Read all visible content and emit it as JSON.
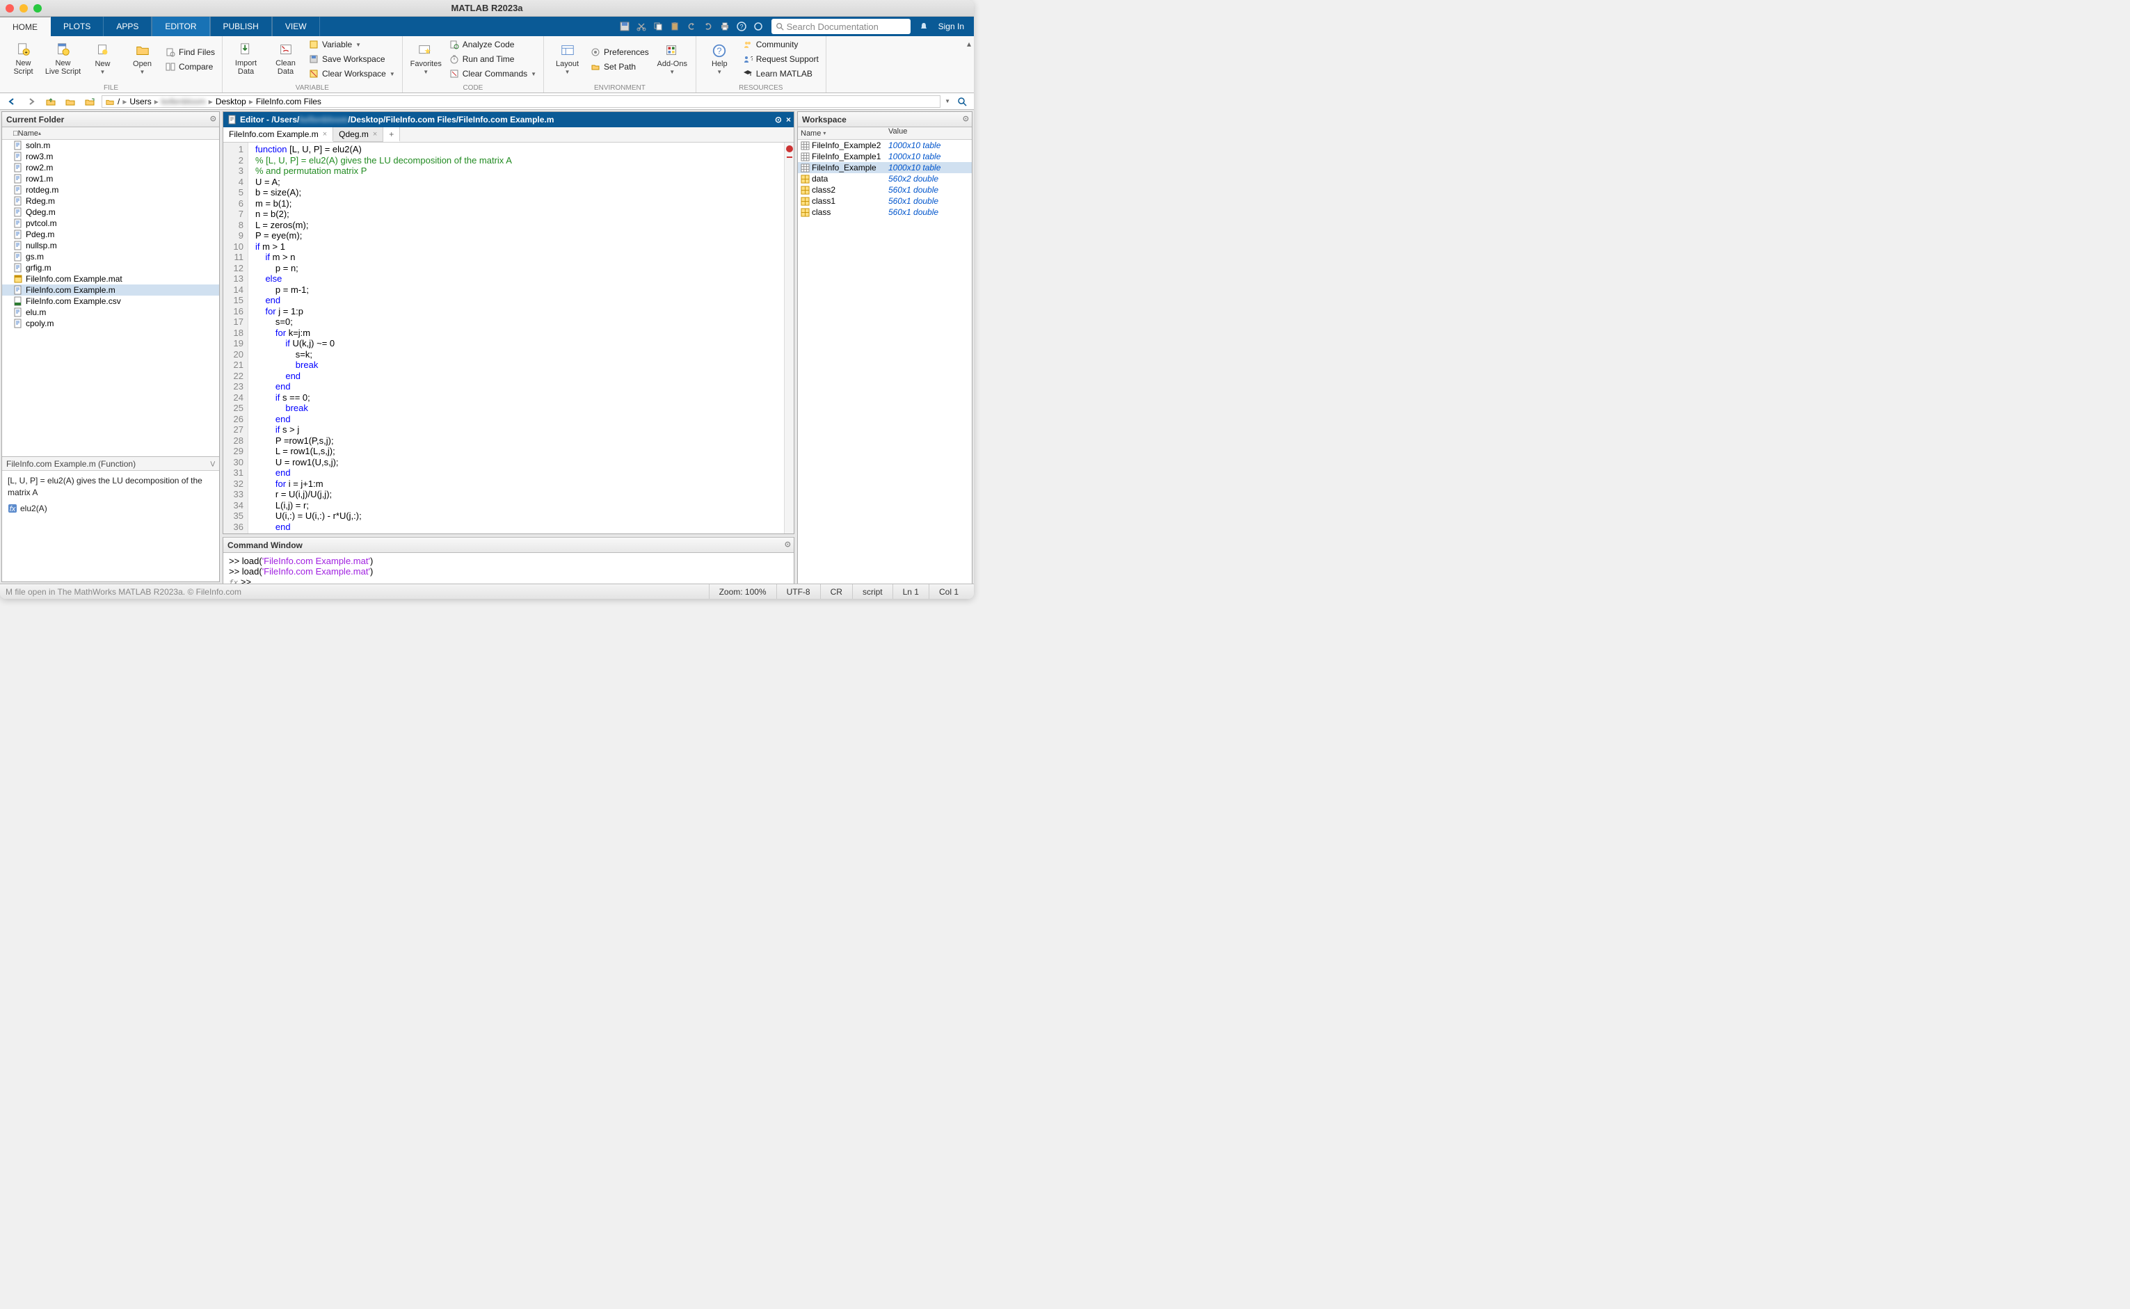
{
  "window_title": "MATLAB R2023a",
  "tabs": {
    "home": "HOME",
    "plots": "PLOTS",
    "apps": "APPS",
    "editor": "EDITOR",
    "publish": "PUBLISH",
    "view": "VIEW"
  },
  "search_placeholder": "Search Documentation",
  "signin_label": "Sign In",
  "toolstrip": {
    "group_file": {
      "label": "FILE",
      "new_script": "New\nScript",
      "new_live_script": "New\nLive Script",
      "new": "New",
      "open": "Open",
      "find_files": "Find Files",
      "compare": "Compare"
    },
    "group_variable": {
      "label": "VARIABLE",
      "import": "Import\nData",
      "clean": "Clean\nData",
      "variable": "Variable",
      "save_ws": "Save Workspace",
      "clear_ws": "Clear Workspace"
    },
    "group_code": {
      "label": "CODE",
      "favorites": "Favorites",
      "analyze": "Analyze Code",
      "runtime": "Run and Time",
      "clear_cmds": "Clear Commands"
    },
    "group_env": {
      "label": "ENVIRONMENT",
      "layout": "Layout",
      "preferences": "Preferences",
      "setpath": "Set Path"
    },
    "group_addons": {
      "addons": "Add-Ons",
      "help": "Help"
    },
    "group_res": {
      "label": "RESOURCES",
      "community": "Community",
      "support": "Request Support",
      "learn": "Learn MATLAB"
    }
  },
  "path": {
    "root": "/",
    "users": "Users",
    "blurred_user": "kellenbloom",
    "desktop": "Desktop",
    "folder": "FileInfo.com Files"
  },
  "current_folder": {
    "title": "Current Folder",
    "col_name": "Name",
    "files": [
      {
        "name": "soln.m",
        "type": "m"
      },
      {
        "name": "row3.m",
        "type": "m"
      },
      {
        "name": "row2.m",
        "type": "m"
      },
      {
        "name": "row1.m",
        "type": "m"
      },
      {
        "name": "rotdeg.m",
        "type": "m"
      },
      {
        "name": "Rdeg.m",
        "type": "m"
      },
      {
        "name": "Qdeg.m",
        "type": "m"
      },
      {
        "name": "pvtcol.m",
        "type": "m"
      },
      {
        "name": "Pdeg.m",
        "type": "m"
      },
      {
        "name": "nullsp.m",
        "type": "m"
      },
      {
        "name": "gs.m",
        "type": "m"
      },
      {
        "name": "grfig.m",
        "type": "m"
      },
      {
        "name": "FileInfo.com Example.mat",
        "type": "mat"
      },
      {
        "name": "FileInfo.com Example.m",
        "type": "m",
        "selected": true
      },
      {
        "name": "FileInfo.com Example.csv",
        "type": "csv"
      },
      {
        "name": "elu.m",
        "type": "m"
      },
      {
        "name": "cpoly.m",
        "type": "m"
      }
    ]
  },
  "detail": {
    "title": "FileInfo.com Example.m  (Function)",
    "body": "[L, U, P] = elu2(A) gives the LU decomposition of the matrix A",
    "fn": "elu2(A)"
  },
  "editor": {
    "title": "Editor - /Users/",
    "title_suffix": "/Desktop/FileInfo.com Files/FileInfo.com Example.m",
    "tabs": [
      {
        "name": "FileInfo.com Example.m",
        "active": true
      },
      {
        "name": "Qdeg.m",
        "active": false
      }
    ],
    "code_lines": [
      [
        [
          "kw",
          "function"
        ],
        [
          "",
          " [L, U, P] = elu2(A)"
        ]
      ],
      [
        [
          "cm",
          "% [L, U, P] = elu2(A) gives the LU decomposition of the matrix A"
        ]
      ],
      [
        [
          "cm",
          "% and permutation matrix P"
        ]
      ],
      [
        [
          "",
          "U = A;"
        ]
      ],
      [
        [
          "",
          "b = size(A);"
        ]
      ],
      [
        [
          "",
          "m = b(1);"
        ]
      ],
      [
        [
          "",
          "n = b(2);"
        ]
      ],
      [
        [
          "",
          "L = zeros(m);"
        ]
      ],
      [
        [
          "",
          "P = eye(m);"
        ]
      ],
      [
        [
          "kw",
          "if"
        ],
        [
          "",
          " m > 1"
        ]
      ],
      [
        [
          "",
          "    "
        ],
        [
          "kw",
          "if"
        ],
        [
          "",
          " m > n"
        ]
      ],
      [
        [
          "",
          "        p = n;"
        ]
      ],
      [
        [
          "",
          "    "
        ],
        [
          "kw",
          "else"
        ]
      ],
      [
        [
          "",
          "        p = m-1;"
        ]
      ],
      [
        [
          "",
          "    "
        ],
        [
          "kw",
          "end"
        ]
      ],
      [
        [
          "",
          "    "
        ],
        [
          "kw",
          "for"
        ],
        [
          "",
          " j = 1:p"
        ]
      ],
      [
        [
          "",
          "        s=0;"
        ]
      ],
      [
        [
          "",
          "        "
        ],
        [
          "kw",
          "for"
        ],
        [
          "",
          " k=j:m"
        ]
      ],
      [
        [
          "",
          "            "
        ],
        [
          "kw",
          "if"
        ],
        [
          "",
          " U(k,j) ~= 0"
        ]
      ],
      [
        [
          "",
          "                s=k;"
        ]
      ],
      [
        [
          "",
          "                "
        ],
        [
          "kw",
          "break"
        ]
      ],
      [
        [
          "",
          "            "
        ],
        [
          "kw",
          "end"
        ]
      ],
      [
        [
          "",
          "        "
        ],
        [
          "kw",
          "end"
        ]
      ],
      [
        [
          "",
          "        "
        ],
        [
          "kw",
          "if"
        ],
        [
          "",
          " s == 0;"
        ]
      ],
      [
        [
          "",
          "            "
        ],
        [
          "kw",
          "break"
        ]
      ],
      [
        [
          "",
          "        "
        ],
        [
          "kw",
          "end"
        ]
      ],
      [
        [
          "",
          "        "
        ],
        [
          "kw",
          "if"
        ],
        [
          "",
          " s > j"
        ]
      ],
      [
        [
          "",
          "        P =row1(P,s,j);"
        ]
      ],
      [
        [
          "",
          "        L = row1(L,s,j);"
        ]
      ],
      [
        [
          "",
          "        U = row1(U,s,j);"
        ]
      ],
      [
        [
          "",
          "        "
        ],
        [
          "kw",
          "end"
        ]
      ],
      [
        [
          "",
          "        "
        ],
        [
          "kw",
          "for"
        ],
        [
          "",
          " i = j+1:m"
        ]
      ],
      [
        [
          "",
          "        r = U(i,j)/U(j,j);"
        ]
      ],
      [
        [
          "",
          "        L(i,j) = r;"
        ]
      ],
      [
        [
          "",
          "        U(i,:) = U(i,:) - r*U(j,:);"
        ]
      ],
      [
        [
          "",
          "        "
        ],
        [
          "kw",
          "end"
        ]
      ]
    ]
  },
  "command_window": {
    "title": "Command Window",
    "lines": [
      {
        "prompt": ">> ",
        "code": "load(",
        "str": "'FileInfo.com Example.mat'",
        "tail": ")"
      },
      {
        "prompt": ">> ",
        "code": "load(",
        "str": "'FileInfo.com Example.mat'",
        "tail": ")"
      }
    ],
    "cursor": ">>"
  },
  "workspace": {
    "title": "Workspace",
    "col_name": "Name",
    "col_value": "Value",
    "vars": [
      {
        "name": "FileInfo_Example2",
        "value": "1000x10 table",
        "icon": "table"
      },
      {
        "name": "FileInfo_Example1",
        "value": "1000x10 table",
        "icon": "table"
      },
      {
        "name": "FileInfo_Example",
        "value": "1000x10 table",
        "icon": "table",
        "selected": true
      },
      {
        "name": "data",
        "value": "560x2 double",
        "icon": "array"
      },
      {
        "name": "class2",
        "value": "560x1 double",
        "icon": "array"
      },
      {
        "name": "class1",
        "value": "560x1 double",
        "icon": "array"
      },
      {
        "name": "class",
        "value": "560x1 double",
        "icon": "array"
      }
    ]
  },
  "statusbar": {
    "left": "M file open in The MathWorks MATLAB R2023a. © FileInfo.com",
    "zoom": "Zoom: 100%",
    "enc": "UTF-8",
    "eol": "CR",
    "lang": "script",
    "ln": "Ln   1",
    "col": "Col   1"
  }
}
